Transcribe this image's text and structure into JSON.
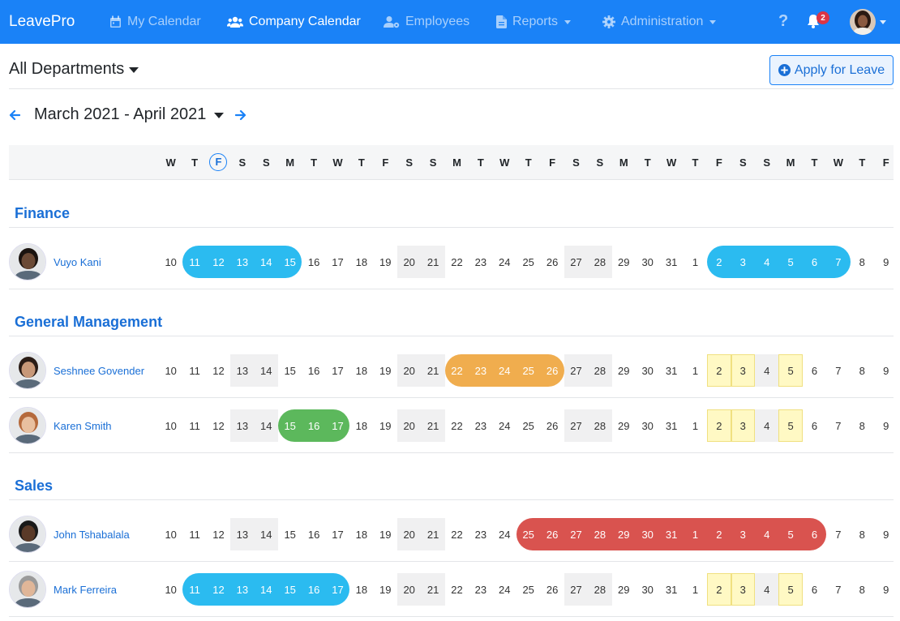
{
  "nav": {
    "brand": "LeavePro",
    "items": [
      {
        "label": "My Calendar",
        "icon": "calendar-icon",
        "active": false,
        "dropdown": false
      },
      {
        "label": "Company Calendar",
        "icon": "users-icon",
        "active": true,
        "dropdown": false
      },
      {
        "label": "Employees",
        "icon": "user-cog-icon",
        "active": false,
        "dropdown": false
      },
      {
        "label": "Reports",
        "icon": "file-icon",
        "active": false,
        "dropdown": true
      },
      {
        "label": "Administration",
        "icon": "gear-icon",
        "active": false,
        "dropdown": true
      }
    ],
    "help": "?",
    "notification_count": "2"
  },
  "header": {
    "department_filter": "All Departments",
    "apply_button": "Apply for Leave",
    "period": "March 2021 - April 2021"
  },
  "calendar": {
    "weekdays": [
      "W",
      "T",
      "F",
      "S",
      "S",
      "M",
      "T",
      "W",
      "T",
      "F",
      "S",
      "S",
      "M",
      "T",
      "W",
      "T",
      "F",
      "S",
      "S",
      "M",
      "T",
      "W",
      "T",
      "F",
      "S",
      "S",
      "M",
      "T",
      "W",
      "T",
      "F"
    ],
    "dates": [
      "10",
      "11",
      "12",
      "13",
      "14",
      "15",
      "16",
      "17",
      "18",
      "19",
      "20",
      "21",
      "22",
      "23",
      "24",
      "25",
      "26",
      "27",
      "28",
      "29",
      "30",
      "31",
      "1",
      "2",
      "3",
      "4",
      "5",
      "6",
      "7",
      "8",
      "9"
    ],
    "today_index": 2,
    "weekend_indices": [
      3,
      4,
      10,
      11,
      17,
      18,
      24,
      25
    ],
    "holiday_indices": [
      23,
      24,
      26
    ],
    "colors": {
      "blue": "#2bbbf0",
      "orange": "#f0ad4e",
      "green": "#5cb85c",
      "red": "#d9534f",
      "holiday": "#fff9c4"
    }
  },
  "departments": [
    {
      "name": "Finance",
      "employees": [
        {
          "name": "Vuyo Kani",
          "skin": "#6b4a36",
          "hair": "#1b1410",
          "holidays": false,
          "leaves": [
            {
              "start": 1,
              "end": 5,
              "color": "blue"
            },
            {
              "start": 23,
              "end": 28,
              "color": "blue"
            }
          ]
        }
      ]
    },
    {
      "name": "General Management",
      "employees": [
        {
          "name": "Seshnee Govender",
          "skin": "#c89878",
          "hair": "#2a1c16",
          "holidays": true,
          "leaves": [
            {
              "start": 12,
              "end": 16,
              "color": "orange"
            }
          ]
        },
        {
          "name": "Karen Smith",
          "skin": "#e8c0a0",
          "hair": "#b56a3c",
          "holidays": true,
          "leaves": [
            {
              "start": 5,
              "end": 7,
              "color": "green"
            }
          ]
        }
      ]
    },
    {
      "name": "Sales",
      "employees": [
        {
          "name": "John Tshabalala",
          "skin": "#5a3a28",
          "hair": "#1a1a1a",
          "holidays": false,
          "leaves": [
            {
              "start": 15,
              "end": 27,
              "color": "red"
            }
          ]
        },
        {
          "name": "Mark Ferreira",
          "skin": "#e0b698",
          "hair": "#9a9a9a",
          "holidays": true,
          "leaves": [
            {
              "start": 1,
              "end": 7,
              "color": "blue"
            }
          ]
        }
      ]
    }
  ]
}
